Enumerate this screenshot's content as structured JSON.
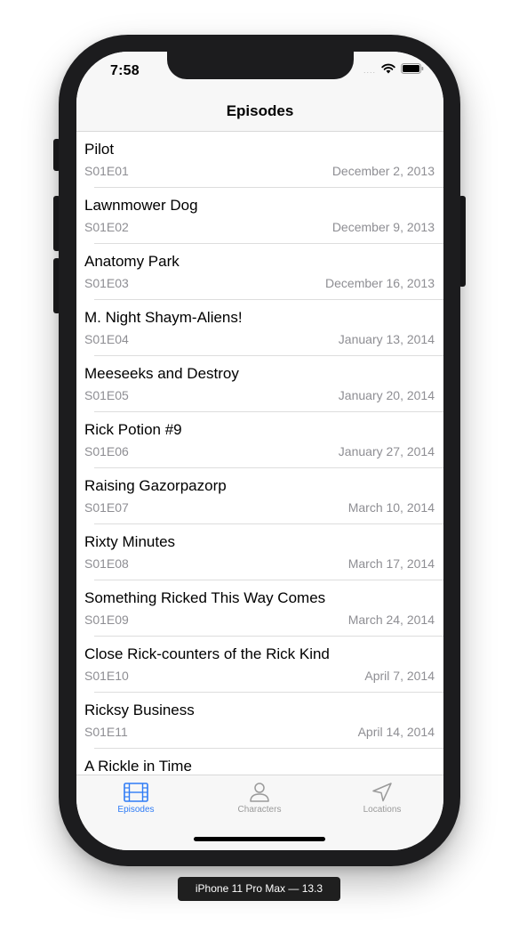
{
  "status_bar": {
    "time": "7:58",
    "signal": "....",
    "wifi_icon": "wifi-icon",
    "battery_icon": "battery-icon"
  },
  "nav": {
    "title": "Episodes"
  },
  "episodes": [
    {
      "title": "Pilot",
      "code": "S01E01",
      "air_date": "December 2, 2013"
    },
    {
      "title": "Lawnmower Dog",
      "code": "S01E02",
      "air_date": "December 9, 2013"
    },
    {
      "title": "Anatomy Park",
      "code": "S01E03",
      "air_date": "December 16, 2013"
    },
    {
      "title": "M. Night Shaym-Aliens!",
      "code": "S01E04",
      "air_date": "January 13, 2014"
    },
    {
      "title": "Meeseeks and Destroy",
      "code": "S01E05",
      "air_date": "January 20, 2014"
    },
    {
      "title": "Rick Potion #9",
      "code": "S01E06",
      "air_date": "January 27, 2014"
    },
    {
      "title": "Raising Gazorpazorp",
      "code": "S01E07",
      "air_date": "March 10, 2014"
    },
    {
      "title": "Rixty Minutes",
      "code": "S01E08",
      "air_date": "March 17, 2014"
    },
    {
      "title": "Something Ricked This Way Comes",
      "code": "S01E09",
      "air_date": "March 24, 2014"
    },
    {
      "title": "Close Rick-counters of the Rick Kind",
      "code": "S01E10",
      "air_date": "April 7, 2014"
    },
    {
      "title": "Ricksy Business",
      "code": "S01E11",
      "air_date": "April 14, 2014"
    },
    {
      "title": "A Rickle in Time",
      "code": "",
      "air_date": ""
    }
  ],
  "tabs": [
    {
      "label": "Episodes",
      "icon": "film-icon",
      "active": true
    },
    {
      "label": "Characters",
      "icon": "person-icon",
      "active": false
    },
    {
      "label": "Locations",
      "icon": "location-arrow-icon",
      "active": false
    }
  ],
  "colors": {
    "accent": "#2f7cf6",
    "inactive": "#9a9a9a",
    "secondary_text": "#8e8e93"
  },
  "device_label": "iPhone 11 Pro Max — 13.3"
}
